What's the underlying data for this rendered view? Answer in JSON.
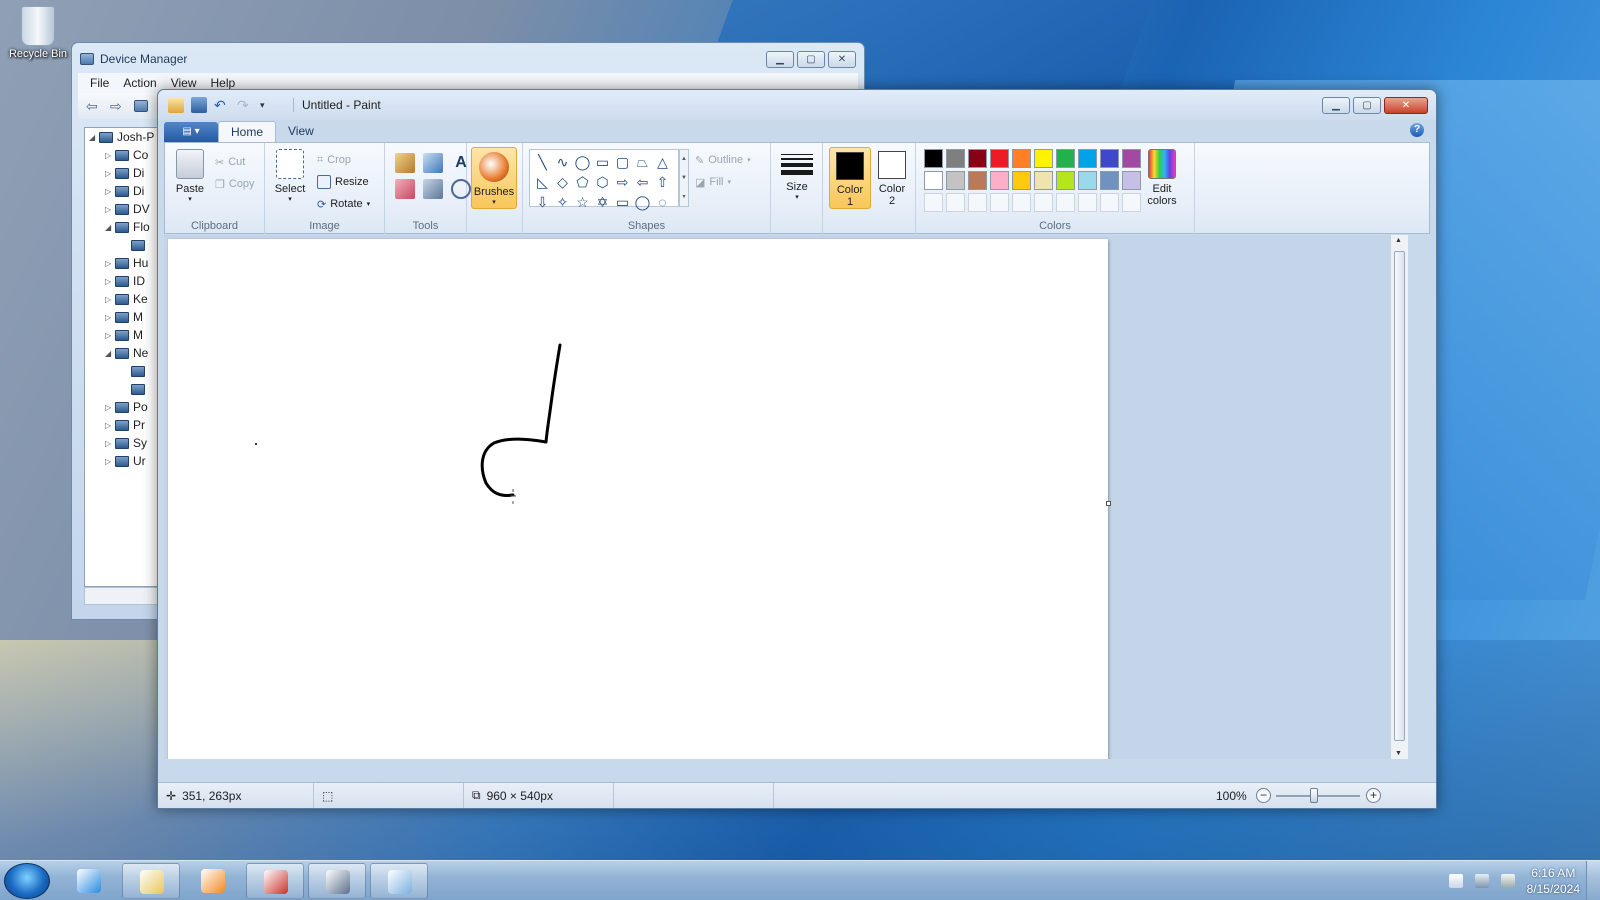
{
  "desktop": {
    "recycle_bin_label": "Recycle Bin"
  },
  "device_manager": {
    "title": "Device Manager",
    "menu": [
      "File",
      "Action",
      "View",
      "Help"
    ],
    "tree": [
      {
        "label": "Josh-P",
        "exp": "◢",
        "indent": 0
      },
      {
        "label": "Co",
        "exp": "▷",
        "indent": 1
      },
      {
        "label": "Di",
        "exp": "▷",
        "indent": 1
      },
      {
        "label": "Di",
        "exp": "▷",
        "indent": 1
      },
      {
        "label": "DV",
        "exp": "▷",
        "indent": 1
      },
      {
        "label": "Flo",
        "exp": "◢",
        "indent": 1
      },
      {
        "label": "",
        "exp": "",
        "indent": 2
      },
      {
        "label": "Hu",
        "exp": "▷",
        "indent": 1
      },
      {
        "label": "ID",
        "exp": "▷",
        "indent": 1
      },
      {
        "label": "Ke",
        "exp": "▷",
        "indent": 1
      },
      {
        "label": "M",
        "exp": "▷",
        "indent": 1
      },
      {
        "label": "M",
        "exp": "▷",
        "indent": 1
      },
      {
        "label": "Ne",
        "exp": "◢",
        "indent": 1
      },
      {
        "label": "",
        "exp": "",
        "indent": 2
      },
      {
        "label": "",
        "exp": "",
        "indent": 2
      },
      {
        "label": "Po",
        "exp": "▷",
        "indent": 1
      },
      {
        "label": "Pr",
        "exp": "▷",
        "indent": 1
      },
      {
        "label": "Sy",
        "exp": "▷",
        "indent": 1
      },
      {
        "label": "Ur",
        "exp": "▷",
        "indent": 1
      }
    ]
  },
  "paint": {
    "title": "Untitled - Paint",
    "tabs": [
      "Home",
      "View"
    ],
    "active_tab": "Home",
    "clipboard": {
      "label": "Clipboard",
      "paste": "Paste",
      "cut": "Cut",
      "copy": "Copy"
    },
    "image": {
      "label": "Image",
      "select": "Select",
      "crop": "Crop",
      "resize": "Resize",
      "rotate": "Rotate"
    },
    "tools": {
      "label": "Tools"
    },
    "brushes": "Brushes",
    "shapes": {
      "label": "Shapes",
      "outline": "Outline",
      "fill": "Fill",
      "glyphs": [
        "╲",
        "∿",
        "◯",
        "▭",
        "▢",
        "⏢",
        "△",
        "◺",
        "◇",
        "⬠",
        "⬡",
        "⇨",
        "⇦",
        "⇧",
        "⇩",
        "✧",
        "☆",
        "✡",
        "▭",
        "◯",
        "◌"
      ]
    },
    "size": "Size",
    "color1": {
      "label": "Color\n1",
      "value": "#000000"
    },
    "color2": {
      "label": "Color\n2",
      "value": "#ffffff"
    },
    "colors_label": "Colors",
    "edit_colors": "Edit\ncolors",
    "palette": [
      "#000000",
      "#7f7f7f",
      "#880015",
      "#ed1c24",
      "#ff7f27",
      "#fff200",
      "#22b14c",
      "#00a2e8",
      "#3f48cc",
      "#a349a4",
      "#ffffff",
      "#c3c3c3",
      "#b97a57",
      "#ffaec9",
      "#ffc90e",
      "#efe4b0",
      "#b5e61d",
      "#99d9ea",
      "#7092be",
      "#c8bfe7",
      "",
      "",
      "",
      "",
      "",
      "",
      "",
      "",
      "",
      ""
    ],
    "status": {
      "cursor_pos": "351, 263px",
      "canvas_size": "960 × 540px",
      "zoom": "100%"
    }
  },
  "taskbar": {
    "apps": [
      {
        "name": "internet-explorer",
        "color": "#2a8be0",
        "open": false
      },
      {
        "name": "file-explorer",
        "color": "#e8c55a",
        "open": true
      },
      {
        "name": "media-player",
        "color": "#f08a24",
        "open": false
      },
      {
        "name": "toolbox",
        "color": "#c8312b",
        "open": true
      },
      {
        "name": "device-manager",
        "color": "#5a6f8c",
        "open": true
      },
      {
        "name": "paint",
        "color": "#7ab0de",
        "open": true
      }
    ],
    "time": "6:16 AM",
    "date": "8/15/2024"
  }
}
